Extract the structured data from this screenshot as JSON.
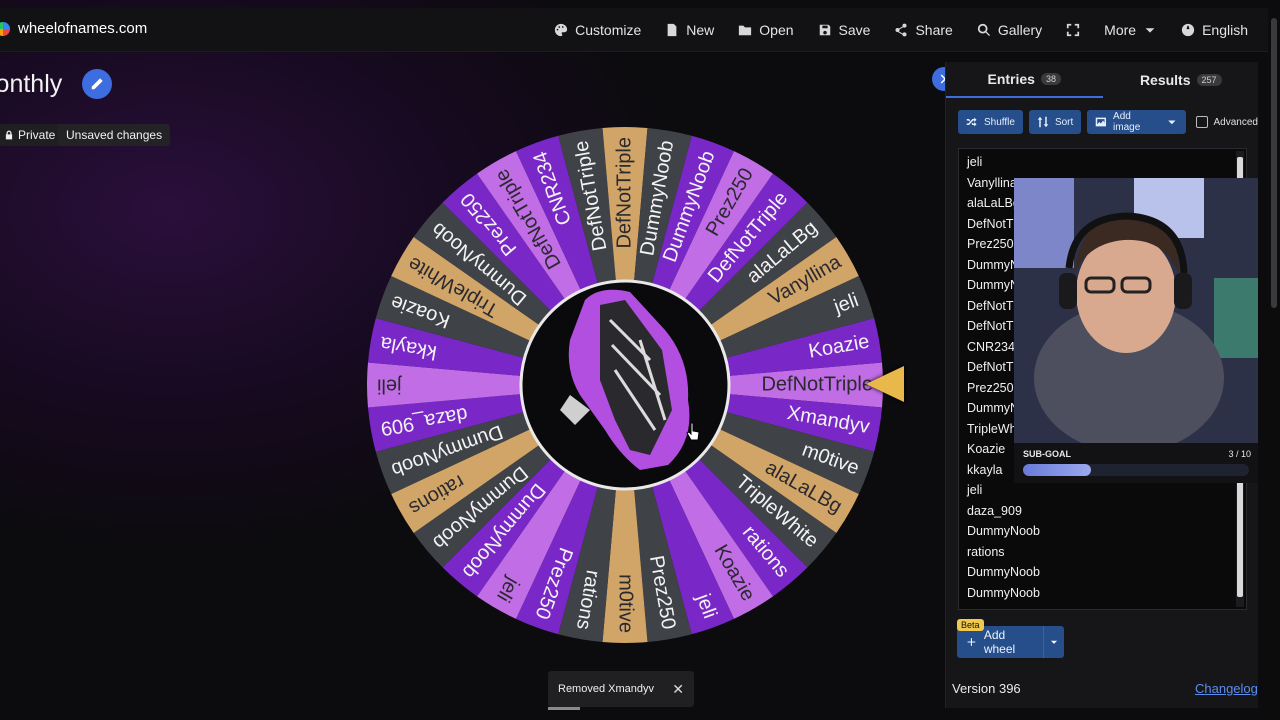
{
  "site": {
    "title": "wheelofnames.com"
  },
  "menu": {
    "items": [
      {
        "label": "Customize",
        "icon": "palette-icon"
      },
      {
        "label": "New",
        "icon": "document-icon"
      },
      {
        "label": "Open",
        "icon": "folder-icon"
      },
      {
        "label": "Save",
        "icon": "save-icon"
      },
      {
        "label": "Share",
        "icon": "share-icon"
      },
      {
        "label": "Gallery",
        "icon": "search-icon"
      },
      {
        "label": "",
        "icon": "fullscreen-icon"
      },
      {
        "label": "More",
        "icon": "chevron-down-icon"
      },
      {
        "label": "English",
        "icon": "globe-icon"
      }
    ]
  },
  "wheel": {
    "title": "lonthly",
    "chips": {
      "private": "Private",
      "unsaved": "Unsaved changes"
    },
    "colors": [
      "#c06de6",
      "#7a27c8",
      "#3f4247",
      "#d1a468",
      "#3f4247",
      "#7a27c8"
    ],
    "segments": [
      "DefNotTriple",
      "Xmandyv",
      "m0tive",
      "alaLaLBg",
      "TripleWhite",
      "rations",
      "Koazie",
      "jeli",
      "Prez250",
      "m0tive",
      "rations",
      "Prez250",
      "jeli",
      "DummyNoob",
      "DummyNoob",
      "rations",
      "DummyNoob",
      "daza_909",
      "jeli",
      "kkayla",
      "Koazie",
      "TripleWhite",
      "DummyNoob",
      "Prez250",
      "DefNotTriple",
      "CNR234",
      "DefNotTriple",
      "DefNotTriple",
      "DummyNoob",
      "DummyNoob",
      "Prez250",
      "DefNotTriple",
      "alaLaLBg",
      "Vanyllina",
      "jeli",
      "Koazie"
    ]
  },
  "panel": {
    "tabs": [
      {
        "label": "Entries",
        "count": "38"
      },
      {
        "label": "Results",
        "count": "257"
      }
    ],
    "actions": {
      "shuffle": "Shuffle",
      "sort": "Sort",
      "add_image": "Add image",
      "advanced": "Advanced"
    },
    "entries": [
      "jeli",
      "Vanyllina",
      "alaLaLBg",
      "DefNotTri",
      "Prez250",
      "DummyN",
      "DummyN",
      "DefNotTri",
      "DefNotTri",
      "CNR234",
      "DefNotTri",
      "Prez250",
      "DummyN",
      "TripleWhi",
      "Koazie",
      "kkayla",
      "jeli",
      "daza_909",
      "DummyNoob",
      "rations",
      "DummyNoob",
      "DummyNoob"
    ],
    "beta": "Beta",
    "add_wheel": "Add wheel",
    "version": "Version 396",
    "changelog": "Changelog"
  },
  "subgoal": {
    "label": "SUB-GOAL",
    "count": "3 / 10",
    "progress": 0.3
  },
  "toast": {
    "message": "Removed Xmandyv",
    "close": "✕"
  }
}
